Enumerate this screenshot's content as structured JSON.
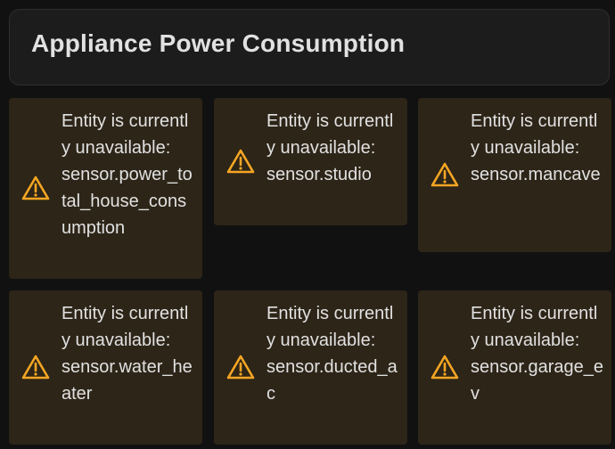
{
  "header": {
    "title": "Appliance Power Consumption"
  },
  "colors": {
    "page_background": "#111111",
    "header_background": "#1c1c1c",
    "warning_card_background": "#2d2518",
    "warning_icon": "#f5a623",
    "text": "#e1e1e1"
  },
  "warnings": [
    {
      "icon": "alert-triangle-icon",
      "message_prefix": "Entity is currently unavailable:",
      "entity": "sensor.power_total_house_consumption"
    },
    {
      "icon": "alert-triangle-icon",
      "message_prefix": "Entity is currently unavailable:",
      "entity": "sensor.studio"
    },
    {
      "icon": "alert-triangle-icon",
      "message_prefix": "Entity is currently unavailable:",
      "entity": "sensor.mancave"
    },
    {
      "icon": "alert-triangle-icon",
      "message_prefix": "Entity is currently unavailable:",
      "entity": "sensor.water_heater"
    },
    {
      "icon": "alert-triangle-icon",
      "message_prefix": "Entity is currently unavailable:",
      "entity": "sensor.ducted_ac"
    },
    {
      "icon": "alert-triangle-icon",
      "message_prefix": "Entity is currently unavailable:",
      "entity": "sensor.garage_ev"
    }
  ]
}
